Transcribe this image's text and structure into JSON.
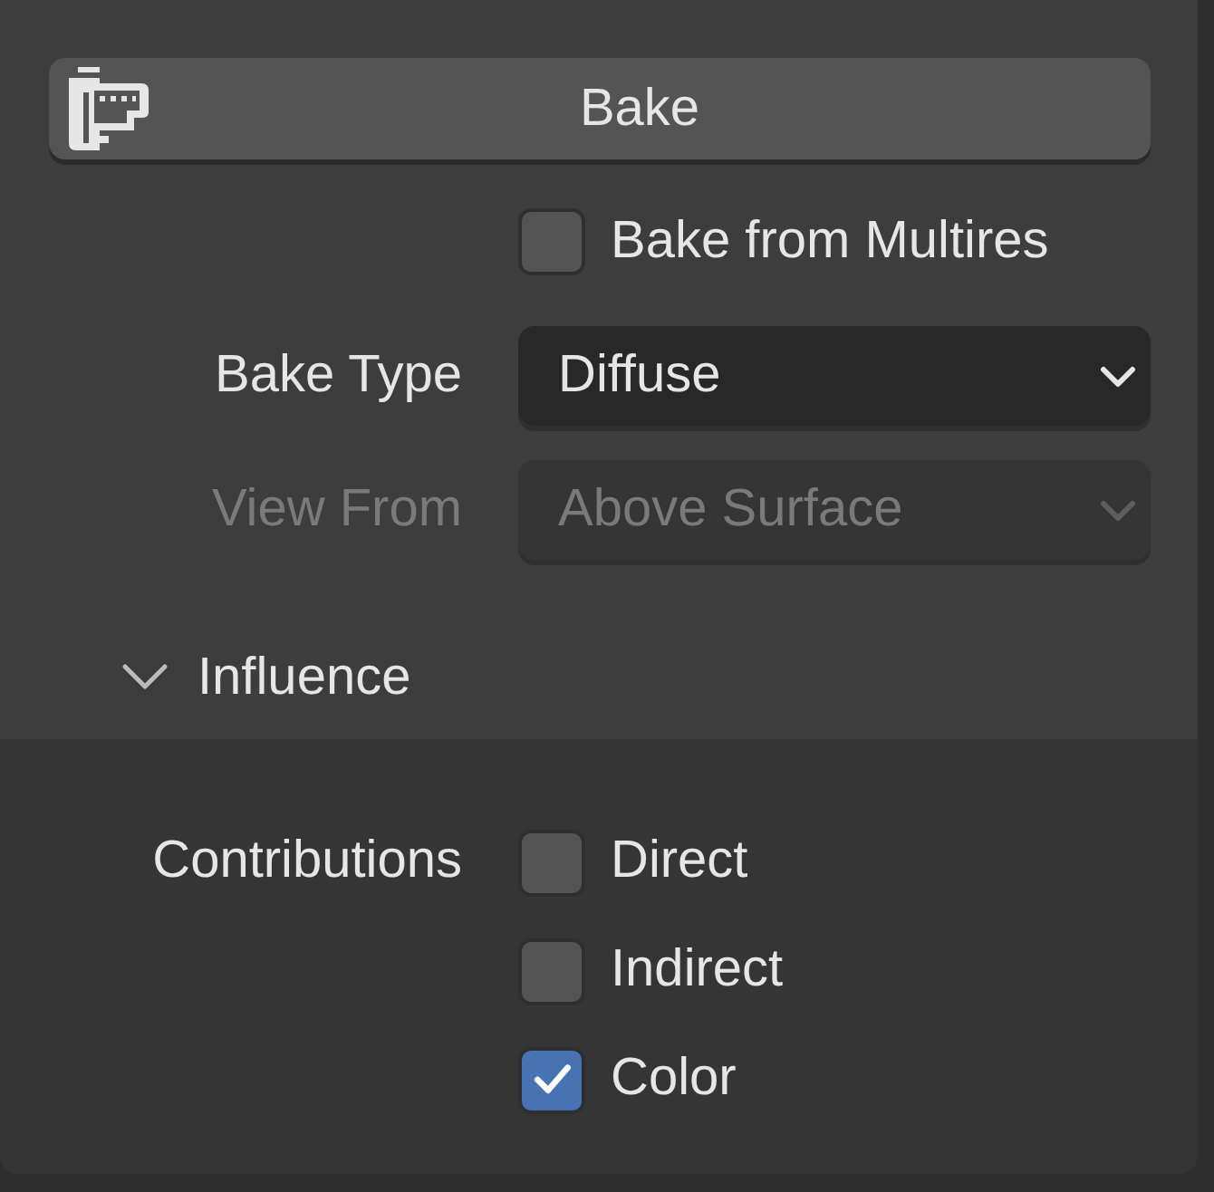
{
  "bake_button": {
    "label": "Bake"
  },
  "bake_from_multires": {
    "label": "Bake from Multires",
    "checked": false
  },
  "fields": [
    {
      "label": "Bake Type",
      "value": "Diffuse",
      "disabled": false
    },
    {
      "label": "View From",
      "value": "Above Surface",
      "disabled": true
    }
  ],
  "influence": {
    "title": "Influence",
    "expanded": true,
    "contributions": {
      "label": "Contributions",
      "options": [
        {
          "label": "Direct",
          "checked": false
        },
        {
          "label": "Indirect",
          "checked": false
        },
        {
          "label": "Color",
          "checked": true
        }
      ]
    }
  }
}
